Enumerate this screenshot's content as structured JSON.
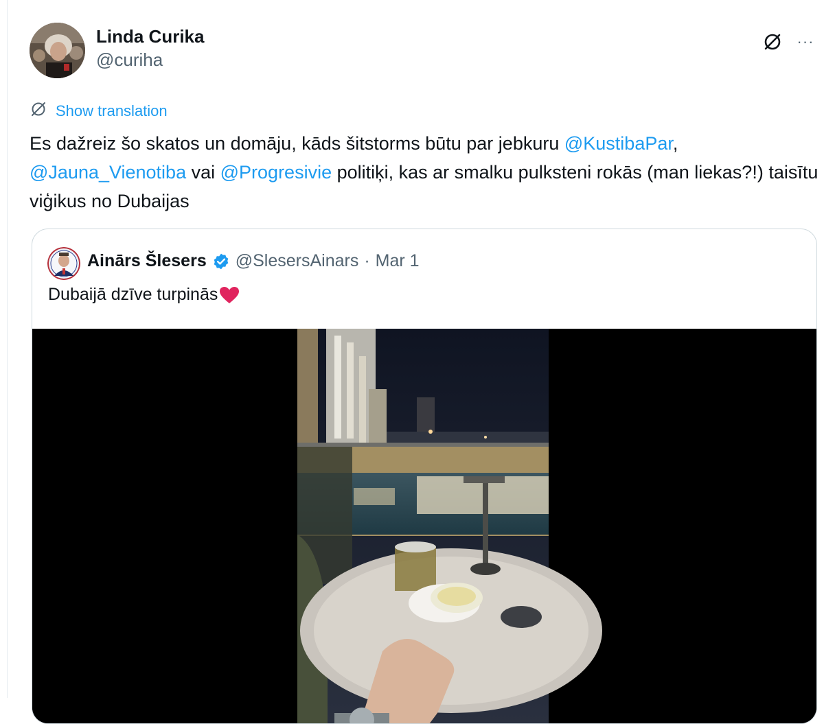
{
  "author": {
    "name": "Linda Curika",
    "handle": "@curiha"
  },
  "actions": {
    "translate_icon": "translate-icon",
    "more_icon": "more-icon",
    "more_label": "···"
  },
  "translation": {
    "label": "Show translation"
  },
  "tweet": {
    "segments": [
      {
        "text": "Es dažreiz šo skatos un domāju, kāds šitstorms būtu par jebkuru "
      },
      {
        "text": "@KustibaPar",
        "mention": true
      },
      {
        "text": ", "
      },
      {
        "text": "@Jauna_Vienotiba",
        "mention": true
      },
      {
        "text": " vai "
      },
      {
        "text": "@Progresivie",
        "mention": true
      },
      {
        "text": " politiķi, kas ar smalku pulksteni rokās (man liekas?!) taisītu viģikus no Dubaijas"
      }
    ]
  },
  "quote": {
    "name": "Ainārs Šlesers",
    "verified": true,
    "handle": "@SlesersAinars",
    "separator": "·",
    "date": "Mar 1",
    "text": "Dubaijā dzīve turpinās",
    "emoji": "heart-emoji"
  },
  "colors": {
    "accent": "#1d9bf0",
    "text": "#0f1419",
    "secondary": "#536471",
    "border": "#cfd9de",
    "heart": "#e0245e"
  }
}
